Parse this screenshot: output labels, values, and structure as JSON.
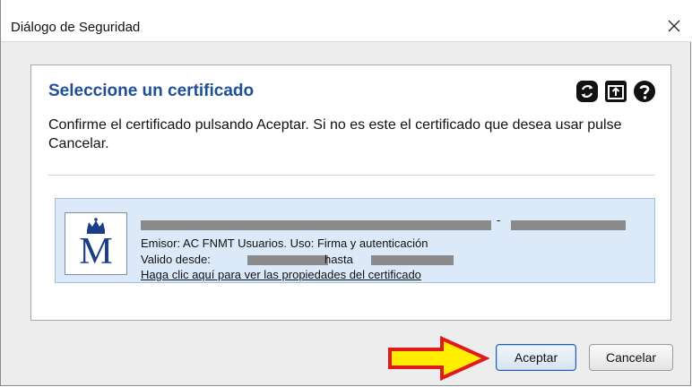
{
  "window": {
    "title": "Diálogo de Seguridad",
    "close_glyph": "✕"
  },
  "panel": {
    "heading": "Seleccione un certificado",
    "icons": [
      "refresh-icon",
      "import-icon",
      "help-icon"
    ],
    "message": "Confirme el certificado pulsando Aceptar. Si no es este el certificado que desea usar pulse Cancelar."
  },
  "certificate": {
    "dash": "-",
    "issuer_line": "Emisor: AC FNMT Usuarios. Uso: Firma y autenticación",
    "valid_from_label": "Valido desde:",
    "valid_to_label": "hasta",
    "properties_link": "Haga clic aquí para ver las propiedades del certificado",
    "logo_letter": "M"
  },
  "buttons": {
    "accept": "Aceptar",
    "cancel": "Cancelar"
  },
  "colors": {
    "heading": "#1f4f99",
    "cert_bg": "#dce9f8",
    "arrow_fill": "#ffee00",
    "arrow_outline": "#e01b1b"
  }
}
